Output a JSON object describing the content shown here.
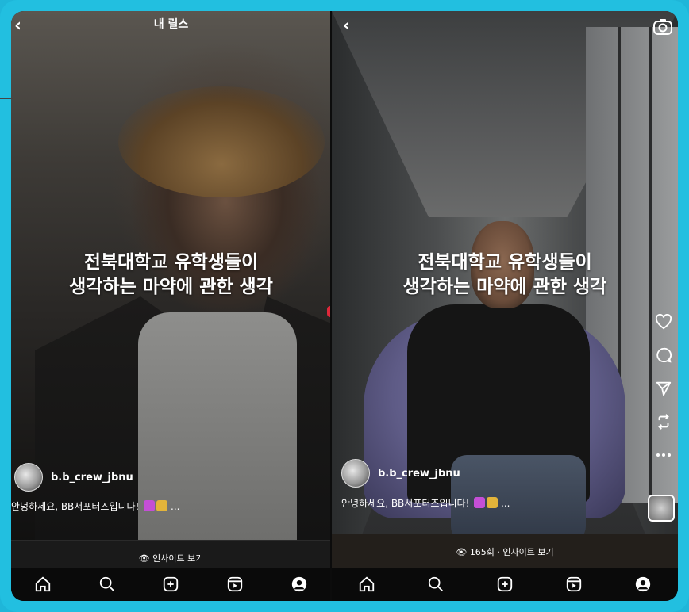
{
  "left_panel": {
    "top_title": "내 릴스",
    "caption_line1": "전북대학교 유학생들이",
    "caption_line2": "생각하는 마약에 관한 생각",
    "username": "b.b_crew_jbnu",
    "description": "안녕하세요, BB서포터즈입니다! ",
    "description_more": " ...",
    "insight": "인사이트 보기",
    "nav": [
      "home-icon",
      "search-icon",
      "create-icon",
      "reels-icon",
      "profile-icon"
    ]
  },
  "right_panel": {
    "caption_line1": "전북대학교 유학생들이",
    "caption_line2": "생각하는 마약에 관한 생각",
    "username": "b.b_crew_jbnu",
    "description": "안녕하세요, BB서포터즈입니다! ",
    "description_more": " ...",
    "insight": "165회 · 인사이트 보기",
    "side_actions": [
      "heart-icon",
      "comment-icon",
      "share-icon",
      "remix-icon",
      "more-icon"
    ],
    "nav": [
      "home-icon",
      "search-icon",
      "create-icon",
      "reels-icon",
      "profile-icon"
    ]
  },
  "colors": {
    "frame": "#22bfe0",
    "accent_red": "#e0283a"
  }
}
